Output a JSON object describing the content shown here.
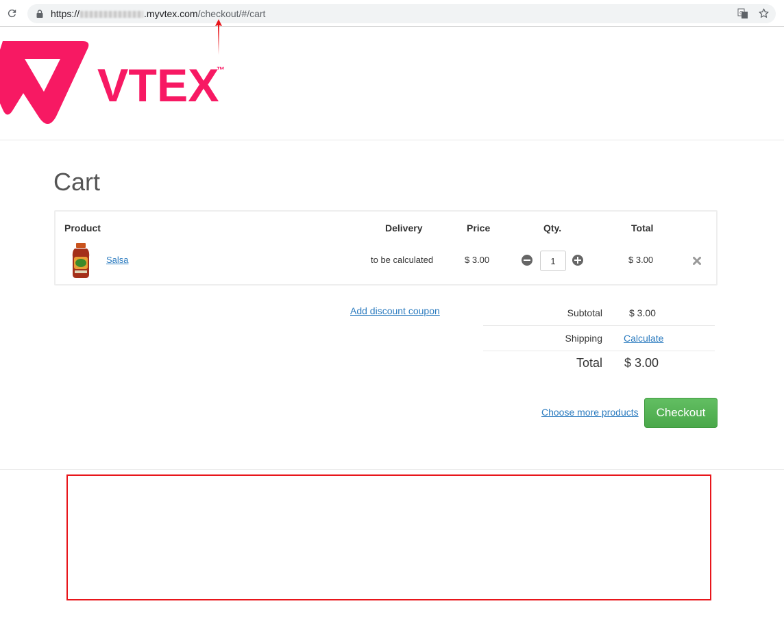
{
  "browser": {
    "url_prefix": "https://",
    "url_host": ".myvtex.com",
    "url_path": "/checkout/#/cart"
  },
  "brand": {
    "name": "VTEX",
    "trademark": "™",
    "color": "#f71963"
  },
  "page": {
    "title": "Cart"
  },
  "cart": {
    "headers": {
      "product": "Product",
      "delivery": "Delivery",
      "price": "Price",
      "qty": "Qty.",
      "total": "Total"
    },
    "items": [
      {
        "name": "Salsa",
        "delivery": "to be calculated",
        "price": "$ 3.00",
        "qty": "1",
        "total": "$ 3.00"
      }
    ]
  },
  "summary": {
    "coupon_link": "Add discount coupon",
    "subtotal_label": "Subtotal",
    "subtotal_value": "$ 3.00",
    "shipping_label": "Shipping",
    "shipping_action": "Calculate",
    "total_label": "Total",
    "total_value": "$ 3.00"
  },
  "actions": {
    "choose_more": "Choose more products",
    "checkout": "Checkout"
  },
  "colors": {
    "link": "#2b7bbf",
    "checkout_button": "#5cb85c",
    "annotation": "#e8161b"
  }
}
